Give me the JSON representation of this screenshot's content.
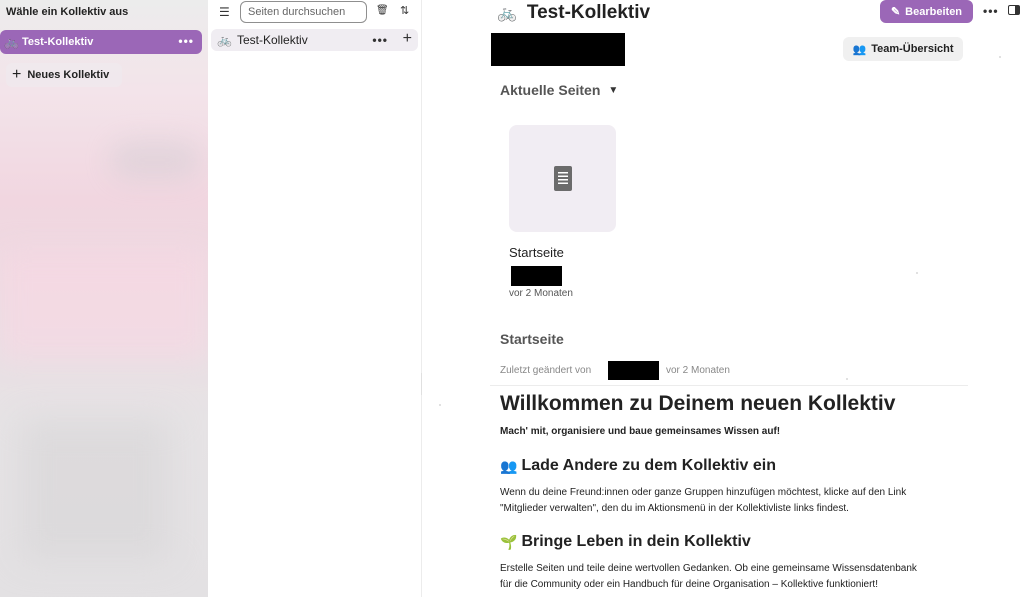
{
  "left_sidebar": {
    "title": "Wähle ein Kollektiv aus",
    "collectives": [
      {
        "label": "Test-Kollektiv",
        "icon": "bicycle-icon",
        "more": "•••"
      }
    ],
    "new_collective": {
      "icon": "plus",
      "label": "Neues Kollektiv"
    }
  },
  "page_list": {
    "search_placeholder": "Seiten durchsuchen",
    "pages": [
      {
        "label": "Test-Kollektiv",
        "icon": "bicycle-icon",
        "more": "•••",
        "add": "+"
      }
    ]
  },
  "main": {
    "title": "Test-Kollektiv",
    "title_icon": "🚲",
    "edit_button": "Bearbeiten",
    "top_more": "•••",
    "team_button": "Team-Übersicht",
    "recent_section": "Aktuelle Seiten",
    "recent_pages": [
      {
        "title": "Startseite",
        "time": "vor 2 Monaten"
      }
    ],
    "page_heading": "Startseite",
    "last_changed_label": "Zuletzt geändert von",
    "last_changed_time": "vor 2 Monaten",
    "content": {
      "h1": "Willkommen zu Deinem neuen Kollektiv",
      "lead": "Mach' mit, organisiere und baue gemeinsames Wissen auf!",
      "sections": [
        {
          "emoji": "👥",
          "heading": "Lade Andere zu dem Kollektiv ein",
          "lines": [
            "Wenn du deine Freund:innen oder ganze Gruppen hinzufügen möchtest, klicke auf den Link",
            "\"Mitglieder verwalten\", den du im Aktionsmenü in der Kollektivliste links findest."
          ]
        },
        {
          "emoji": "🌱",
          "heading": "Bringe Leben in dein Kollektiv",
          "lines": [
            "Erstelle Seiten und teile deine wertvollen Gedanken. Ob eine gemeinsame Wissensdatenbank",
            "für die Community oder ein Handbuch für deine Organisation – Kollektive funktioniert!"
          ]
        }
      ]
    }
  },
  "colors": {
    "accent": "#9b67b7",
    "tile_bg": "#f1edf3",
    "page_item_bg": "#f0edf2"
  }
}
